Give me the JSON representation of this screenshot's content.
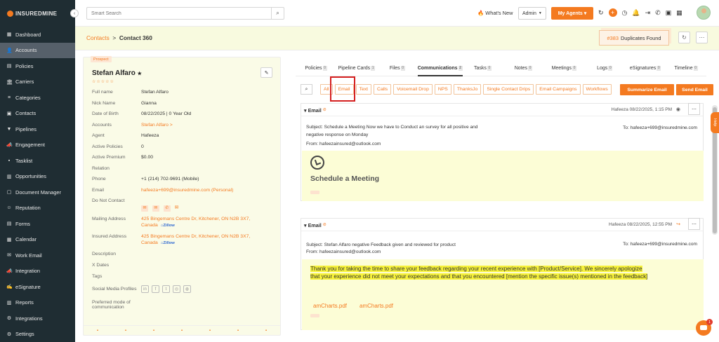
{
  "sidebar": {
    "logo": "INSUREDMINE",
    "collapse_icon": "chevron-left-icon",
    "items": [
      {
        "label": "Dashboard",
        "icon": "grid-icon",
        "glyph": "▦"
      },
      {
        "label": "Accounts",
        "icon": "user-icon",
        "glyph": "👤"
      },
      {
        "label": "Policies",
        "icon": "file-icon",
        "glyph": "▤"
      },
      {
        "label": "Carriers",
        "icon": "building-icon",
        "glyph": "🏛"
      },
      {
        "label": "Categories",
        "icon": "layers-icon",
        "glyph": "≡"
      },
      {
        "label": "Contacts",
        "icon": "contact-card-icon",
        "glyph": "▣"
      },
      {
        "label": "Pipelines",
        "icon": "funnel-icon",
        "glyph": "▼"
      },
      {
        "label": "Engagement",
        "icon": "megaphone-icon",
        "glyph": "📣"
      },
      {
        "label": "Tasklist",
        "icon": "task-icon",
        "glyph": "▪"
      },
      {
        "label": "Opportunities",
        "icon": "chart-icon",
        "glyph": "▥"
      },
      {
        "label": "Document Manager",
        "icon": "document-icon",
        "glyph": "▢"
      },
      {
        "label": "Reputation",
        "icon": "reputation-icon",
        "glyph": "☺"
      },
      {
        "label": "Forms",
        "icon": "form-icon",
        "glyph": "▤"
      },
      {
        "label": "Calendar",
        "icon": "calendar-icon",
        "glyph": "▦"
      },
      {
        "label": "Work Email",
        "icon": "mail-icon",
        "glyph": "✉"
      },
      {
        "label": "Integration",
        "icon": "megaphone-icon",
        "glyph": "📣"
      },
      {
        "label": "eSignature",
        "icon": "signature-icon",
        "glyph": "✍"
      },
      {
        "label": "Reports",
        "icon": "bar-chart-icon",
        "glyph": "▥"
      },
      {
        "label": "Integrations",
        "icon": "cogs-icon",
        "glyph": "⚙"
      },
      {
        "label": "Settings",
        "icon": "gear-icon",
        "glyph": "⚙"
      }
    ]
  },
  "topbar": {
    "search_placeholder": "Smart Search",
    "whats_new": "What's New",
    "admin": "Admin",
    "my_agents": "My Agents"
  },
  "breadcrumb": {
    "parent": "Contacts",
    "separator": ">",
    "current": "Contact 360"
  },
  "duplicates": {
    "count": "#383",
    "label": "Duplicates Found"
  },
  "profile": {
    "badge": "Prospect",
    "name": "Stefan Alfaro",
    "name_star": "★",
    "stars": "☆☆☆☆☆",
    "fields": [
      {
        "label": "Full name",
        "value": "Stefan Alfaro",
        "orange": false
      },
      {
        "label": "Nick Name",
        "value": "Gianna",
        "orange": false
      },
      {
        "label": "Date of Birth",
        "value": "08/22/2025 | 0 Year Old",
        "orange": false
      },
      {
        "label": "Accounts",
        "value": "Stefan Alfaro >",
        "orange": true
      },
      {
        "label": "Agent",
        "value": "Hafeeza",
        "orange": false
      },
      {
        "label": "Active Policies",
        "value": "0",
        "orange": false
      },
      {
        "label": "Active Premium",
        "value": "$0.00",
        "orange": false
      },
      {
        "label": "Relation",
        "value": "",
        "orange": false
      },
      {
        "label": "Phone",
        "value": "+1 (214) 702-9691 (Mobile)",
        "orange": false
      },
      {
        "label": "Email",
        "value": "hafeeza+699@insuredmine.com  (Personal)",
        "orange": true
      },
      {
        "label": "Do Not Contact",
        "value": "",
        "orange": false
      }
    ],
    "mailing_label": "Mailing Address",
    "mailing_line1": "425 Bingemans Centre Dr, Kitchener, ON N2B 3X7,",
    "mailing_line2": "Canada",
    "insured_label": "Insured Address",
    "insured_line1": "425 Bingemans Centre Dr, Kitchener, ON N2B 3X7,",
    "insured_line2": "Canada",
    "zillow": "Zillow",
    "description": "Description",
    "xdates": "X Dates",
    "tags": "Tags",
    "social": "Social Media Profiles",
    "preferred_line1": "Preferred mode of",
    "preferred_line2": "communication"
  },
  "tabs": [
    {
      "label": "Policies",
      "count": "0"
    },
    {
      "label": "Pipeline Cards",
      "count": "1"
    },
    {
      "label": "Files",
      "count": "0"
    },
    {
      "label": "Communications",
      "count": "2"
    },
    {
      "label": "Tasks",
      "count": "0"
    },
    {
      "label": "Notes",
      "count": "0"
    },
    {
      "label": "Meetings",
      "count": "0"
    },
    {
      "label": "Logs",
      "count": "0"
    },
    {
      "label": "eSignatures",
      "count": "0"
    },
    {
      "label": "Timeline",
      "count": "0"
    }
  ],
  "filters": [
    "All",
    "Email",
    "Text",
    "Calls",
    "Voicemail Drop",
    "NPS",
    "ThanksJo",
    "Single Contact Drips",
    "Email Campaigns",
    "Workflows"
  ],
  "actions": {
    "summarize": "Summarize Email",
    "send": "Send Email"
  },
  "emails": [
    {
      "title": "Email",
      "meta": "Hafeeza 08/22/2025, 1:15 PM",
      "subject_line1": "Subject: Schedule a Meeting Now we have to Conduct an survey for all positive and",
      "subject_line2": "negative response on Monday",
      "to": "To: hafeeza+699@insuredmine.com",
      "from": "From: hafeezainsured@outlook.com",
      "heading": "Schedule a Meeting"
    },
    {
      "title": "Email",
      "meta": "Hafeeza 08/22/2025, 12:55 PM",
      "subject": "Subject: Stefan Alfaro negative Feedback given and reviewed for product",
      "to": "To: hafeeza+699@insuredmine.com",
      "from": "From: hafeezainsured@outlook.com",
      "body_line1": "Thank you for taking the time to share your feedback regarding your recent experience with [Product/Service].  We sincerely apologize",
      "body_line2": "that your experience did not meet your expectations and that you encountered [mention the specific issue(s) mentioned in the feedback]",
      "attachments": [
        "amCharts.pdf",
        "amCharts.pdf"
      ]
    }
  ],
  "help": "Help",
  "chat_badge": "1"
}
